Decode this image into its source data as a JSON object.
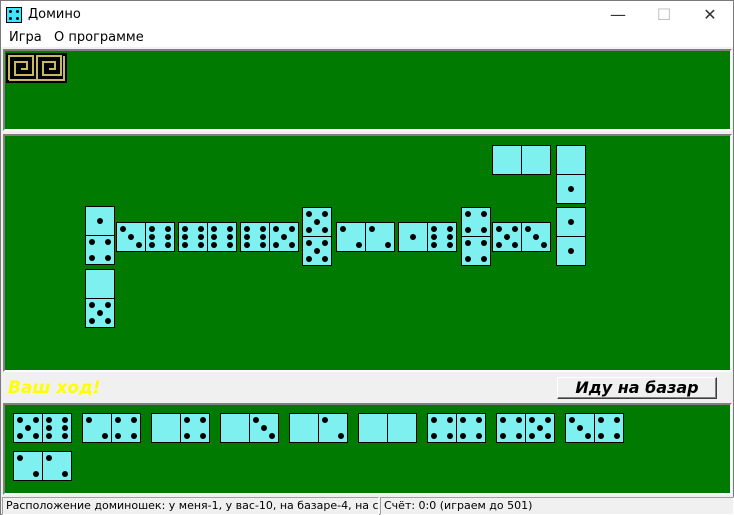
{
  "window": {
    "title": "Домино"
  },
  "menu": [
    "Игра",
    "О программе"
  ],
  "turn_text": "Ваш ход!",
  "bazar_button": "Иду на базар",
  "status": {
    "layout": "Расположение доминошек:  у меня-1, у вас-10, на базаре-4, на ст",
    "score": "Счёт:  0:0 (играем до 501)"
  },
  "colors": {
    "table": "#007a00",
    "tile_face": "#7ff0f0",
    "turn_text": "#ffff00"
  },
  "board_tiles": [
    [
      1,
      4
    ],
    [
      0,
      5
    ],
    [
      3,
      6
    ],
    [
      6,
      6
    ],
    [
      6,
      5
    ],
    [
      5,
      5
    ],
    [
      2,
      2
    ],
    [
      1,
      6
    ],
    [
      4,
      4
    ],
    [
      5,
      3
    ],
    [
      1,
      1
    ],
    [
      0,
      1
    ],
    [
      0,
      0
    ],
    [
      6,
      0
    ],
    [
      2,
      5
    ],
    [
      3,
      3
    ],
    [
      2,
      3
    ],
    [
      3,
      2
    ],
    [
      2,
      1
    ],
    [
      1,
      1
    ]
  ],
  "hand_tiles": [
    [
      5,
      6
    ],
    [
      2,
      4
    ],
    [
      0,
      4
    ],
    [
      0,
      3
    ],
    [
      0,
      2
    ],
    [
      0,
      0
    ],
    [
      4,
      4
    ],
    [
      4,
      5
    ],
    [
      3,
      4
    ],
    [
      2,
      2
    ]
  ]
}
